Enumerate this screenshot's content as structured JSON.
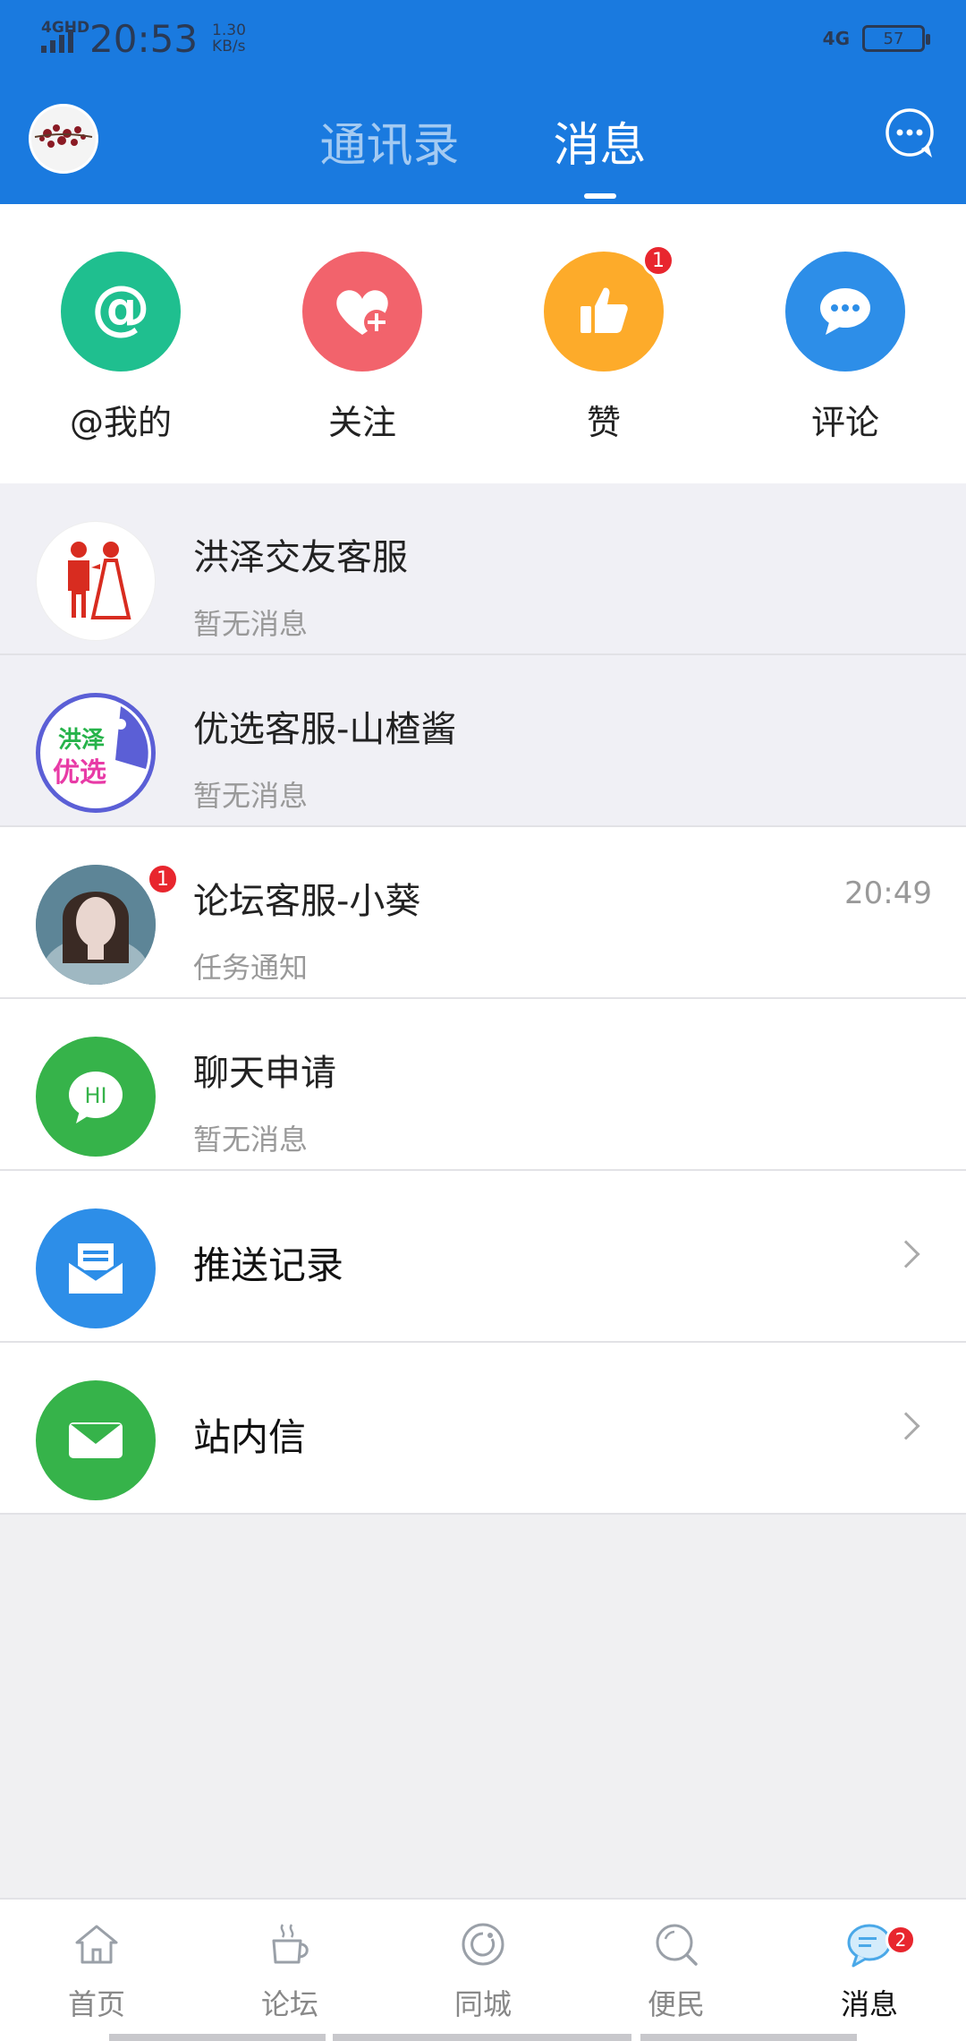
{
  "status": {
    "network_label": "4GHD",
    "time": "20:53",
    "speed_value": "1.30",
    "speed_unit": "KB/s",
    "net_type": "4G",
    "battery": "57"
  },
  "header": {
    "tabs": [
      {
        "label": "通讯录",
        "active": false
      },
      {
        "label": "消息",
        "active": true
      }
    ],
    "colors": {
      "brand": "#1a7adf"
    }
  },
  "quick_actions": [
    {
      "label": "@我的",
      "color": "#1fbf8f",
      "icon": "at-icon",
      "badge": null
    },
    {
      "label": "关注",
      "color": "#f2636c",
      "icon": "heart-plus-icon",
      "badge": null
    },
    {
      "label": "赞",
      "color": "#fdab2a",
      "icon": "thumbs-up-icon",
      "badge": "1"
    },
    {
      "label": "评论",
      "color": "#2d8ee8",
      "icon": "comment-icon",
      "badge": null
    }
  ],
  "conversations": [
    {
      "name": "洪泽交友客服",
      "subtitle": "暂无消息",
      "time": "",
      "badge": null
    },
    {
      "name": "优选客服-山楂酱",
      "subtitle": "暂无消息",
      "time": "",
      "badge": null,
      "logo_top": "洪泽",
      "logo_bottom": "优选"
    },
    {
      "name": "论坛客服-小葵",
      "subtitle": "任务通知",
      "time": "20:49",
      "badge": "1"
    },
    {
      "name": "聊天申请",
      "subtitle": "暂无消息",
      "time": "",
      "badge": null,
      "icon_text": "HI"
    }
  ],
  "links": [
    {
      "label": "推送记录",
      "icon": "push-record-icon",
      "color": "#2d8ee8"
    },
    {
      "label": "站内信",
      "icon": "mail-icon",
      "color": "#36b34a"
    }
  ],
  "bottom_nav": [
    {
      "label": "首页",
      "icon": "home-icon",
      "active": false
    },
    {
      "label": "论坛",
      "icon": "coffee-icon",
      "active": false
    },
    {
      "label": "同城",
      "icon": "location-icon",
      "active": false
    },
    {
      "label": "便民",
      "icon": "search-icon",
      "active": false
    },
    {
      "label": "消息",
      "icon": "message-icon",
      "active": true,
      "badge": "2"
    }
  ]
}
